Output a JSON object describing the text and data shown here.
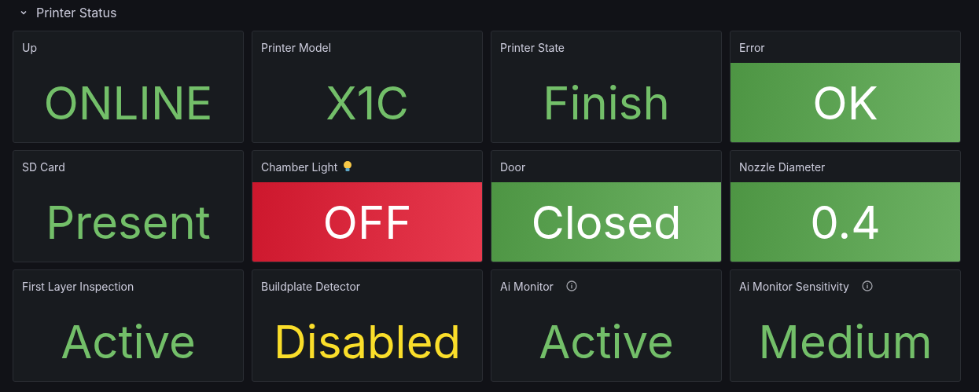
{
  "section": {
    "title": "Printer Status",
    "expanded": true
  },
  "panels": [
    {
      "title": "Up",
      "value": "ONLINE",
      "kind": "text",
      "color": "#73bf69",
      "info": false,
      "bulb": false
    },
    {
      "title": "Printer Model",
      "value": "X1C",
      "kind": "text",
      "color": "#73bf69",
      "info": false,
      "bulb": false
    },
    {
      "title": "Printer State",
      "value": "Finish",
      "kind": "text",
      "color": "#73bf69",
      "info": false,
      "bulb": false
    },
    {
      "title": "Error",
      "value": "OK",
      "kind": "background",
      "color": "#56a64b",
      "info": false,
      "bulb": false
    },
    {
      "title": "SD Card",
      "value": "Present",
      "kind": "text",
      "color": "#73bf69",
      "info": false,
      "bulb": false
    },
    {
      "title": "Chamber Light",
      "value": "OFF",
      "kind": "background",
      "color": "#e41a32",
      "info": false,
      "bulb": true
    },
    {
      "title": "Door",
      "value": "Closed",
      "kind": "background",
      "color": "#56a64b",
      "info": false,
      "bulb": false
    },
    {
      "title": "Nozzle Diameter",
      "value": "0.4",
      "kind": "background",
      "color": "#56a64b",
      "info": false,
      "bulb": false
    },
    {
      "title": "First Layer Inspection",
      "value": "Active",
      "kind": "text",
      "color": "#73bf69",
      "info": false,
      "bulb": false
    },
    {
      "title": "Buildplate Detector",
      "value": "Disabled",
      "kind": "text",
      "color": "#fade2a",
      "info": false,
      "bulb": false
    },
    {
      "title": "Ai Monitor",
      "value": "Active",
      "kind": "text",
      "color": "#73bf69",
      "info": true,
      "bulb": false
    },
    {
      "title": "Ai Monitor Sensitivity",
      "value": "Medium",
      "kind": "text",
      "color": "#73bf69",
      "info": true,
      "bulb": false
    }
  ]
}
